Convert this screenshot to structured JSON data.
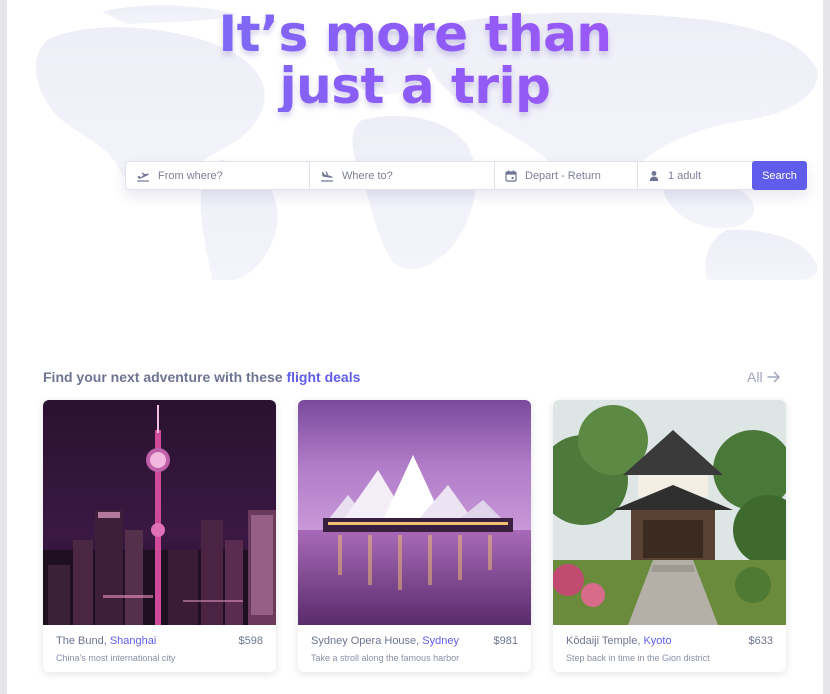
{
  "hero": {
    "line1": "It’s more than",
    "line2": "just a trip"
  },
  "search": {
    "from_placeholder": "From where?",
    "to_placeholder": "Where to?",
    "date_placeholder": "Depart - Return",
    "passengers": "1 adult",
    "button": "Search"
  },
  "deals": {
    "title_prefix": "Find your next adventure with these",
    "title_accent": "flight deals",
    "all_label": "All"
  },
  "cards": [
    {
      "place": "The Bund,",
      "city": "Shanghai",
      "price": "$598",
      "description": "China’s most international city",
      "image": "shanghai-skyline-night"
    },
    {
      "place": "Sydney Opera House,",
      "city": "Sydney",
      "price": "$981",
      "description": "Take a stroll along the famous harbor",
      "image": "sydney-opera-house-dusk"
    },
    {
      "place": "Kōdaiji Temple,",
      "city": "Kyoto",
      "price": "$633",
      "description": "Step back in time in the Gion district",
      "image": "kyoto-temple-garden"
    }
  ],
  "colors": {
    "accent": "#605dec",
    "text": "#6e7491",
    "muted": "#a1a5bd"
  }
}
